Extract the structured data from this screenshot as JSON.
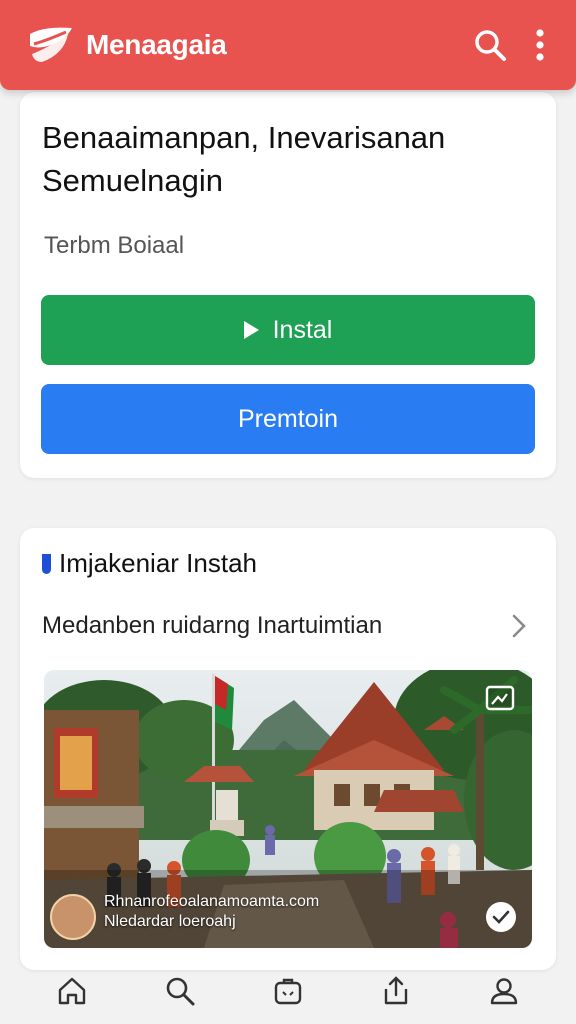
{
  "appbar": {
    "title": "Menaagaia",
    "brand_color": "#e9534f",
    "icons": [
      "logo-icon",
      "search-icon",
      "more-vert-icon"
    ]
  },
  "app_card": {
    "headline": "Benaaimanpan, Inevarisanan Semuelnagin",
    "subtitle": "Terbm Boiaal",
    "install_label": "Instal",
    "install_color": "#1fa155",
    "premium_label": "Premtoin",
    "premium_color": "#2a7cf2"
  },
  "section": {
    "title": "Imjakeniar Instah",
    "row_label": "Medanben ruidarng Inartuimtian",
    "media": {
      "caption_line1": "Rhnanrofeoalanamoamta.com",
      "caption_line2": "Nledardar loeroahj"
    }
  },
  "bottom_nav": {
    "items": [
      "home-icon",
      "search-icon",
      "bag-icon",
      "share-icon",
      "profile-icon"
    ]
  }
}
